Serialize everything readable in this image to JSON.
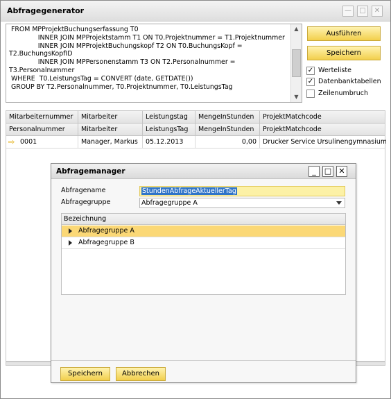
{
  "window": {
    "title": "Abfragegenerator",
    "controls": [
      "minimize",
      "maximize",
      "close"
    ]
  },
  "sql": {
    "text": " FROM MPProjektBuchungserfassung T0\n              INNER JOIN MPProjektstamm T1 ON T0.Projektnummer = T1.Projektnummer\n              INNER JOIN MPProjektBuchungskopf T2 ON T0.BuchungsKopf =\nT2.BuchungsKopfID\n              INNER JOIN MPPersonenstamm T3 ON T2.Personalnummer =\nT3.Personalnummer\n WHERE  T0.LeistungsTag = CONVERT (date, GETDATE())\n GROUP BY T2.Personalnummer, T0.Projektnummer, T0.LeistungsTag"
  },
  "actions": {
    "execute": "Ausführen",
    "save": "Speichern"
  },
  "options": [
    {
      "label": "Werteliste",
      "checked": true
    },
    {
      "label": "Datenbanktabellen",
      "checked": true
    },
    {
      "label": "Zeilenumbruch",
      "checked": false
    }
  ],
  "results": {
    "header1": [
      "Mitarbeiternummer",
      "Mitarbeiter",
      "Leistungstag",
      "MengeInStunden",
      "ProjektMatchcode"
    ],
    "header2": [
      "Personalnummer",
      "Mitarbeiter",
      "LeistungsTag",
      "MengeInStunden",
      "ProjektMatchcode"
    ],
    "rows": [
      [
        "0001",
        "Manager, Markus",
        "05.12.2013",
        "0,00",
        "Drucker Service Ursulinengymnasium"
      ]
    ]
  },
  "dialog": {
    "title": "Abfragemanager",
    "name_label": "Abfragename",
    "name_value": "StundenAbfrageAktuellerTag",
    "group_label": "Abfragegruppe",
    "group_value": "Abfragegruppe A",
    "list_header": "Bezeichnung",
    "list_items": [
      "Abfragegruppe A",
      "Abfragegruppe B"
    ],
    "selected_index": 0,
    "save": "Speichern",
    "cancel": "Abbrechen"
  },
  "colors": {
    "accent": "#f2cf4c",
    "selection_row": "#fbd876",
    "text_highlight": "#2f74c8"
  }
}
